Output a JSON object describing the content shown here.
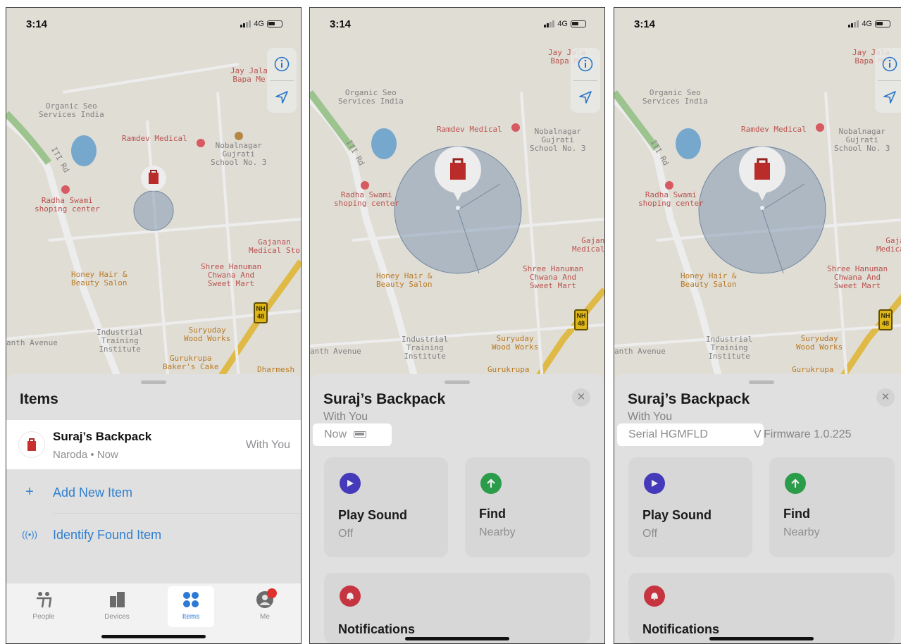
{
  "status": {
    "time": "3:14",
    "network": "4G"
  },
  "map": {
    "labels": {
      "organic_seo": "Organic Seo\nServices India",
      "jay_jalaram": "Jay Jala\nBapa Me",
      "ramdev": "Ramdev Medical",
      "nobalnagar": "Nobalnagar\nGujrati\nSchool No. 3",
      "iti_rd": "ITI Rd",
      "radha": "Radha Swami\nshoping center",
      "gajanan": "Gajanan\nMedical Sto",
      "shree": "Shree Hanuman\nChwana And\nSweet Mart",
      "honey": "Honey Hair &\nBeauty Salon",
      "nh": "NH\n48",
      "industrial": "Industrial\nTraining\nInstitute",
      "suryuday": "Suryuday\nWood Works",
      "gurukrupa": "Gurukrupa\nBaker's Cake",
      "dharmesh": "Dharmesh",
      "anth_avenue": "anth Avenue"
    }
  },
  "screen1": {
    "sheet_title": "Items",
    "item": {
      "name": "Suraj’s Backpack",
      "location": "Naroda • Now",
      "status": "With You"
    },
    "actions": [
      {
        "icon": "plus-icon",
        "label": "Add New Item"
      },
      {
        "icon": "airtag-signal-icon",
        "label": "Identify Found Item"
      }
    ],
    "tabs": [
      {
        "icon": "people-icon",
        "label": "People"
      },
      {
        "icon": "devices-icon",
        "label": "Devices"
      },
      {
        "icon": "items-icon",
        "label": "Items"
      },
      {
        "icon": "me-icon",
        "label": "Me"
      }
    ]
  },
  "screen2": {
    "title": "Suraj’s Backpack",
    "subtitle": "With You",
    "info": "Now",
    "cards": [
      {
        "icon": "play-icon",
        "color": "#4a3fc9",
        "title": "Play Sound",
        "sub": "Off"
      },
      {
        "icon": "arrow-up-icon",
        "color": "#2fa84f",
        "title": "Find",
        "sub": "Nearby"
      },
      {
        "icon": "bell-icon",
        "color": "#d63845",
        "title": "Notifications",
        "sub": ""
      }
    ]
  },
  "screen3": {
    "title": "Suraj’s Backpack",
    "subtitle": "With You",
    "serial": "Serial HGMFLD",
    "serial_suffix": "V",
    "firmware": "Firmware 1.0.225",
    "cards": [
      {
        "icon": "play-icon",
        "color": "#4a3fc9",
        "title": "Play Sound",
        "sub": "Off"
      },
      {
        "icon": "arrow-up-icon",
        "color": "#2fa84f",
        "title": "Find",
        "sub": "Nearby"
      },
      {
        "icon": "bell-icon",
        "color": "#d63845",
        "title": "Notifications",
        "sub": ""
      }
    ]
  }
}
